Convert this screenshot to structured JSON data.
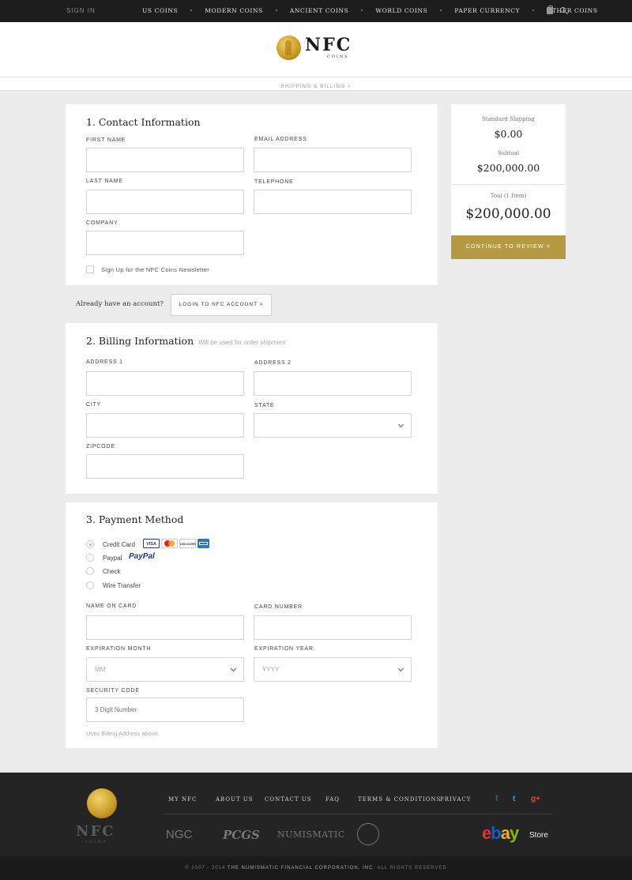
{
  "topnav": {
    "signin": "SIGN IN",
    "menu": [
      "US COINS",
      "MODERN COINS",
      "ANCIENT COINS",
      "WORLD COINS",
      "PAPER CURRENCY",
      "OTHER COINS"
    ]
  },
  "brand": {
    "name": "NFC",
    "sub": "COINS"
  },
  "breadcrumb": "SHIPPING & BILLING  >",
  "contact": {
    "title": "1. Contact Information",
    "first_name": "FIRST NAME",
    "email": "EMAIL ADDRESS",
    "last_name": "LAST NAME",
    "telephone": "TELEPHONE",
    "company": "COMPANY",
    "newsletter": "Sign Up for the NFC Coins Newsletter"
  },
  "account": {
    "prompt": "Already have an account?",
    "login_button": "LOGIN TO NFC ACCOUNT  >"
  },
  "billing": {
    "title": "2. Billing Information",
    "hint": "Will be used for order shipment",
    "address1": "ADDRESS 1",
    "address2": "ADDRESS 2",
    "city": "CITY",
    "state": "STATE",
    "zipcode": "ZIPCODE"
  },
  "payment": {
    "title": "3. Payment Method",
    "options": [
      "Credit Card",
      "Paypal",
      "Check",
      "Wire Transfer"
    ],
    "paypal_logo": "PayPal",
    "cards": [
      "VISA",
      "MC",
      "DISCOVER",
      "AMEX"
    ],
    "name_on_card": "NAME ON CARD",
    "card_number": "CARD NUMBER",
    "exp_month": "EXPIRATION MONTH",
    "exp_month_placeholder": "MM",
    "exp_year": "EXPIRATION  YEAR",
    "exp_year_placeholder": "YYYY",
    "security_code": "SECURITY CODE",
    "security_placeholder": "3 Digit Number",
    "note": "Uses Billing Address above."
  },
  "summary": {
    "shipping_label": "Standard Shipping",
    "shipping_value": "$0.00",
    "subtotal_label": "Subtoal",
    "subtotal_value": "$200,000.00",
    "total_label": "Toal (1 Item)",
    "total_value": "$200,000.00",
    "continue_button": "CONTINUE TO REVIEW  >"
  },
  "footer": {
    "links": [
      "MY NFC",
      "ABOUT US",
      "CONTACT US",
      "FAQ",
      "TERMS & CONDITIONS",
      "PRIVACY"
    ],
    "social": [
      "f",
      "t",
      "g+"
    ],
    "associations": [
      "NGC",
      "PCGS",
      "NUMISMATIC"
    ],
    "ebay": "ebay",
    "store": "Store",
    "copyright_prefix": "© 2007 - 2014",
    "copyright_company": "THE NUMISMATIC FINANCIAL CORPORATION, INC.",
    "copyright_suffix": "ALL RIGHTS RESERVED"
  },
  "colors": {
    "gold": "#b59a43",
    "nav_bg": "#1d1d1d",
    "footer_bg": "#242424"
  }
}
